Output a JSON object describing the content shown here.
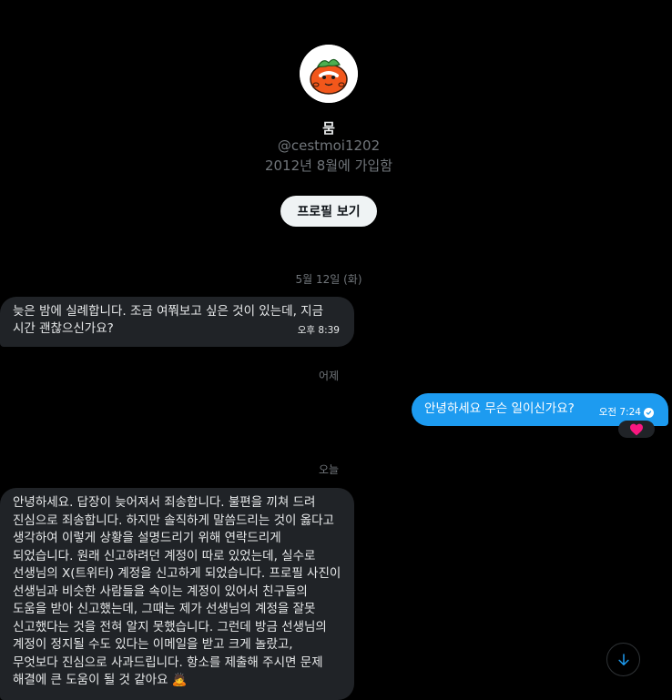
{
  "profile": {
    "name": "뭄",
    "handle": "@cestmoi1202",
    "joined": "2012년 8월에 가입함",
    "view_profile_label": "프로필 보기",
    "avatar_icon": "persimmon-character-icon"
  },
  "conversation": {
    "date_separators": [
      "5월 12일 (화)",
      "어제",
      "오늘"
    ],
    "messages": [
      {
        "direction": "received",
        "text": "늦은 밤에 실례합니다. 조금 여쭤보고 싶은 것이 있는데, 지금 시간 괜찮으신가요?",
        "time": "오후 8:39"
      },
      {
        "direction": "sent",
        "text": "안녕하세요 무슨 일이신가요?",
        "time": "오전 7:24",
        "status_icon": "read-check-icon",
        "reaction": "❤️"
      },
      {
        "direction": "received",
        "text": "안녕하세요. 답장이 늦어져서 죄송합니다. 불편을 끼쳐 드려 진심으로 죄송합니다. 하지만 솔직하게 말씀드리는 것이 옳다고 생각하여 이렇게 상황을 설명드리기 위해 연락드리게 되었습니다. 원래 신고하려던 계정이 따로 있었는데, 실수로 선생님의 X(트위터) 계정을 신고하게 되었습니다. 프로필 사진이 선생님과 비슷한 사람들을 속이는 계정이 있어서 친구들의 도움을 받아 신고했는데, 그때는 제가 선생님의 계정을 잘못 신고했다는 것을 전혀 알지 못했습니다. 그런데 방금 선생님의 계정이 정지될 수도 있다는 이메일을 받고 크게 놀랐고, 무엇보다 진심으로 사과드립니다. 항소를 제출해 주시면 문제 해결에 큰 도움이 될 것 같아요 🙇"
      }
    ]
  },
  "controls": {
    "scroll_down_icon": "arrow-down-icon"
  },
  "colors": {
    "background": "#000000",
    "received_bubble": "#202327",
    "sent_bubble": "#1d9bf0",
    "secondary_text": "#71767b",
    "reaction_heart": "#f91880"
  }
}
